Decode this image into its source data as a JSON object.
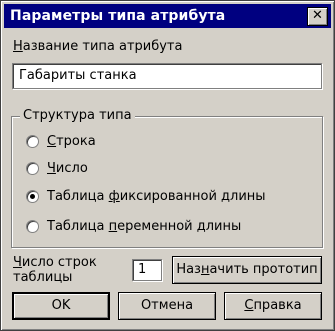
{
  "dialog": {
    "title": "Параметры типа атрибута",
    "close_glyph": "✕"
  },
  "name_field": {
    "label_prefix": "",
    "label_accel": "Н",
    "label_rest": "азвание типа атрибута",
    "value": "Габариты станка"
  },
  "structure": {
    "legend": "Структура типа",
    "options": [
      {
        "pre": "",
        "accel": "С",
        "post": "трока",
        "checked": false
      },
      {
        "pre": "",
        "accel": "Ч",
        "post": "исло",
        "checked": false
      },
      {
        "pre": "Таблица ",
        "accel": "ф",
        "post": "иксированной длины",
        "checked": true
      },
      {
        "pre": "Таблица ",
        "accel": "п",
        "post": "еременной длины",
        "checked": false
      }
    ]
  },
  "rows": {
    "label_accel": "Ч",
    "label_line1_rest": "исло строк",
    "label_line2": "таблицы",
    "value": "1"
  },
  "buttons": {
    "assign_pre": "Наз",
    "assign_accel": "н",
    "assign_post": "ачить прототип",
    "ok": "OK",
    "cancel": "Отмена",
    "help_accel": "С",
    "help_post": "правка"
  }
}
